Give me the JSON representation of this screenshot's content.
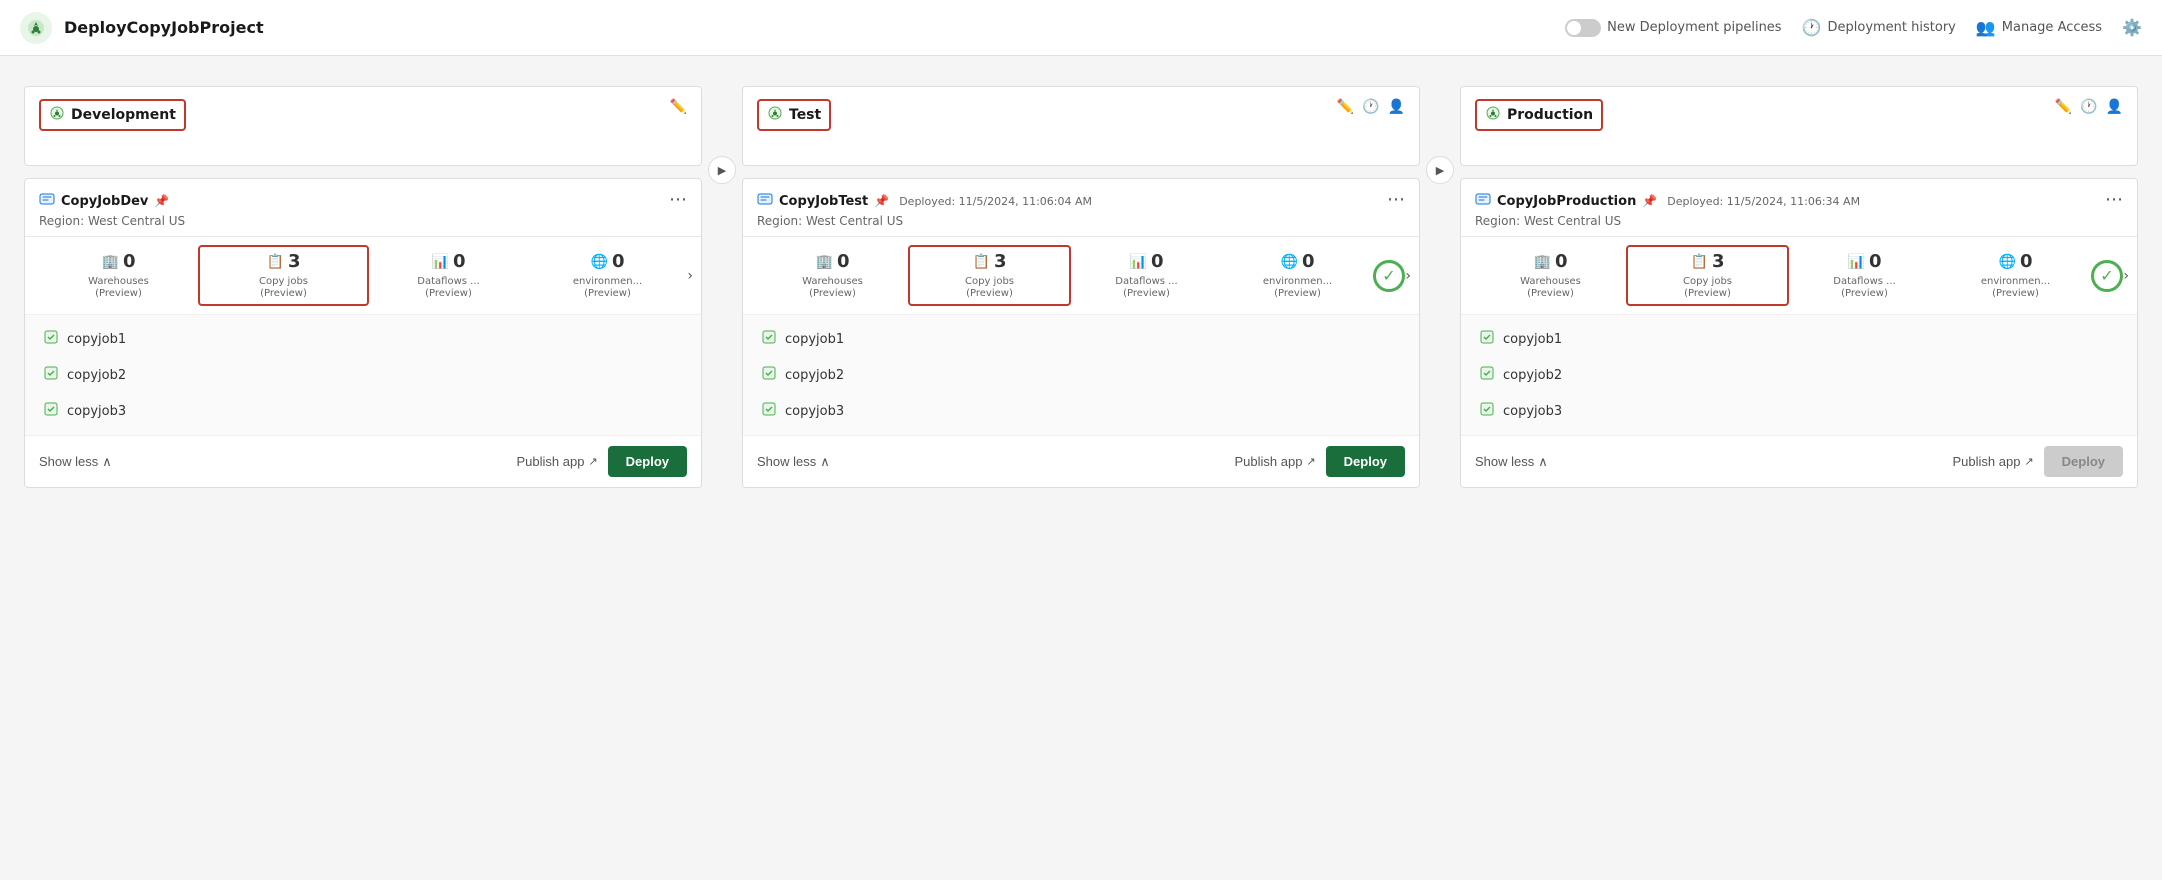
{
  "header": {
    "logo_icon": "🚀",
    "title": "DeployCopyJobProject",
    "toggle_label": "New Deployment pipelines",
    "history_label": "Deployment history",
    "access_label": "Manage Access"
  },
  "stages": [
    {
      "id": "development",
      "name": "Development",
      "icon": "🚀",
      "show_edit": true,
      "show_history": false,
      "show_assign": false,
      "card": {
        "title": "CopyJobDev",
        "deployed_text": "",
        "region": "Region: West Central US",
        "stats": [
          {
            "icon": "🏢",
            "count": "0",
            "label": "Warehouses\n(Preview)",
            "highlighted": false
          },
          {
            "icon": "📋",
            "count": "3",
            "label": "Copy jobs\n(Preview)",
            "highlighted": true
          },
          {
            "icon": "📊",
            "count": "0",
            "label": "Dataflows ...\n(Preview)",
            "highlighted": false
          },
          {
            "icon": "🌐",
            "count": "0",
            "label": "environmen...\n(Preview)",
            "highlighted": false
          }
        ],
        "show_success": false,
        "items": [
          {
            "name": "copyjob1"
          },
          {
            "name": "copyjob2"
          },
          {
            "name": "copyjob3"
          }
        ],
        "show_less_label": "Show less",
        "publish_label": "Publish app",
        "deploy_label": "Deploy",
        "deploy_disabled": false
      }
    },
    {
      "id": "test",
      "name": "Test",
      "icon": "🚀",
      "show_edit": true,
      "show_history": true,
      "show_assign": true,
      "card": {
        "title": "CopyJobTest",
        "deployed_text": "Deployed: 11/5/2024, 11:06:04 AM",
        "region": "Region: West Central US",
        "stats": [
          {
            "icon": "🏢",
            "count": "0",
            "label": "Warehouses\n(Preview)",
            "highlighted": false
          },
          {
            "icon": "📋",
            "count": "3",
            "label": "Copy jobs\n(Preview)",
            "highlighted": true
          },
          {
            "icon": "📊",
            "count": "0",
            "label": "Dataflows ...\n(Preview)",
            "highlighted": false
          },
          {
            "icon": "🌐",
            "count": "0",
            "label": "environmen...\n(Preview)",
            "highlighted": false
          }
        ],
        "show_success": true,
        "items": [
          {
            "name": "copyjob1"
          },
          {
            "name": "copyjob2"
          },
          {
            "name": "copyjob3"
          }
        ],
        "show_less_label": "Show less",
        "publish_label": "Publish app",
        "deploy_label": "Deploy",
        "deploy_disabled": false
      }
    },
    {
      "id": "production",
      "name": "Production",
      "icon": "🚀",
      "show_edit": true,
      "show_history": true,
      "show_assign": true,
      "card": {
        "title": "CopyJobProduction",
        "deployed_text": "Deployed: 11/5/2024, 11:06:34 AM",
        "region": "Region: West Central US",
        "stats": [
          {
            "icon": "🏢",
            "count": "0",
            "label": "Warehouses\n(Preview)",
            "highlighted": false
          },
          {
            "icon": "📋",
            "count": "3",
            "label": "Copy jobs\n(Preview)",
            "highlighted": true
          },
          {
            "icon": "📊",
            "count": "0",
            "label": "Dataflows ...\n(Preview)",
            "highlighted": false
          },
          {
            "icon": "🌐",
            "count": "0",
            "label": "environmen...\n(Preview)",
            "highlighted": false
          }
        ],
        "show_success": true,
        "items": [
          {
            "name": "copyjob1"
          },
          {
            "name": "copyjob2"
          },
          {
            "name": "copyjob3"
          }
        ],
        "show_less_label": "Show less",
        "publish_label": "Publish app",
        "deploy_label": "Deploy",
        "deploy_disabled": true
      }
    }
  ]
}
